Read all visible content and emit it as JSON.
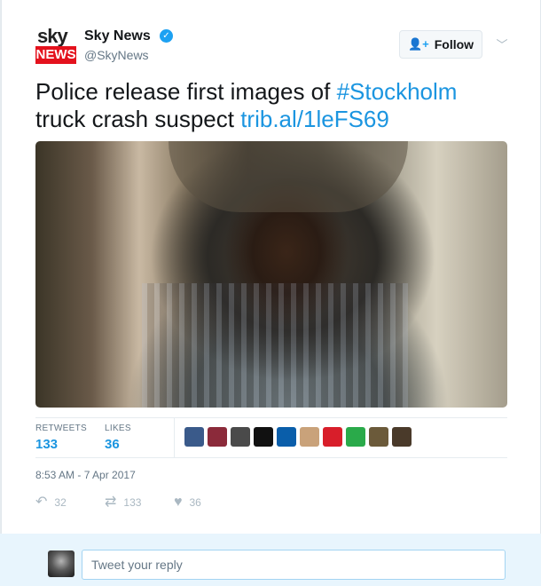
{
  "account": {
    "logo_text_top": "sky",
    "logo_text_bottom": "NEWS",
    "name": "Sky News",
    "handle": "@SkyNews",
    "verified": true
  },
  "follow_button": {
    "label": "Follow",
    "icon": "add-user-icon"
  },
  "menu": {
    "icon": "chevron-down-icon"
  },
  "tweet": {
    "text_part1": "Police release first images of ",
    "hashtag": "#Stockholm",
    "text_part2": "truck crash suspect ",
    "link": "trib.al/1leFS69"
  },
  "media": {
    "type": "photo"
  },
  "stats": {
    "retweets_label": "RETWEETS",
    "retweets_count": "133",
    "likes_label": "LIKES",
    "likes_count": "36"
  },
  "likers": [
    {
      "icon": "user-avatar-1",
      "color": "#3a5a8a"
    },
    {
      "icon": "user-avatar-2",
      "color": "#8b2a3a"
    },
    {
      "icon": "user-avatar-3",
      "color": "#4a4a4a"
    },
    {
      "icon": "user-avatar-4",
      "color": "#111111"
    },
    {
      "icon": "sweden-flag-avatar",
      "color": "#0a5eaa"
    },
    {
      "icon": "user-avatar-6",
      "color": "#c9a27a"
    },
    {
      "icon": "uk-badge-avatar",
      "color": "#d81e2a"
    },
    {
      "icon": "user-avatar-8",
      "color": "#2aaa4a"
    },
    {
      "icon": "user-avatar-9",
      "color": "#6b5a3a"
    },
    {
      "icon": "user-avatar-10",
      "color": "#4a3a2a"
    }
  ],
  "timestamp": "8:53 AM - 7 Apr 2017",
  "actions": {
    "reply_count": "32",
    "retweet_count": "133",
    "like_count": "36"
  },
  "reply": {
    "placeholder": "Tweet your reply"
  },
  "colors": {
    "accent": "#1b95e0",
    "brand_red": "#e4121d"
  }
}
